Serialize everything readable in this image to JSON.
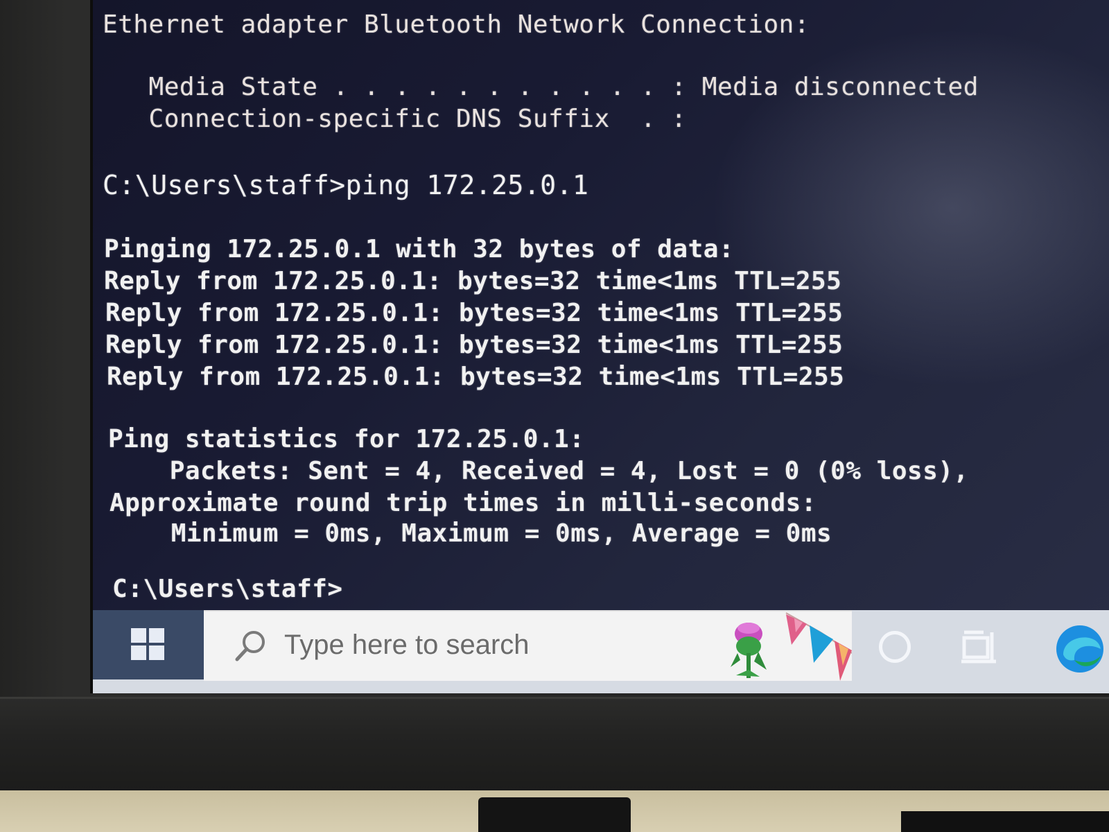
{
  "console": {
    "lines": [
      "Ethernet adapter Bluetooth Network Connection:",
      "   Media State . . . . . . . . . . . : Media disconnected",
      "   Connection-specific DNS Suffix  . :",
      "C:\\Users\\staff>ping 172.25.0.1",
      "Pinging 172.25.0.1 with 32 bytes of data:",
      "Reply from 172.25.0.1: bytes=32 time<1ms TTL=255",
      "Reply from 172.25.0.1: bytes=32 time<1ms TTL=255",
      "Reply from 172.25.0.1: bytes=32 time<1ms TTL=255",
      "Reply from 172.25.0.1: bytes=32 time<1ms TTL=255",
      "Ping statistics for 172.25.0.1:",
      "    Packets: Sent = 4, Received = 4, Lost = 0 (0% loss),",
      "Approximate round trip times in milli-seconds:",
      "    Minimum = 0ms, Maximum = 0ms, Average = 0ms",
      "C:\\Users\\staff>"
    ]
  },
  "taskbar": {
    "search_placeholder": "Type here to search",
    "icons": {
      "start": "windows-logo",
      "search": "search-icon",
      "cortana": "cortana-icon",
      "task_view": "task-view-icon",
      "edge": "edge-icon"
    },
    "colors": {
      "start_bg": "#3a4a66",
      "taskbar_bg": "#d6dbe3",
      "search_bg": "#f3f3f3"
    }
  }
}
